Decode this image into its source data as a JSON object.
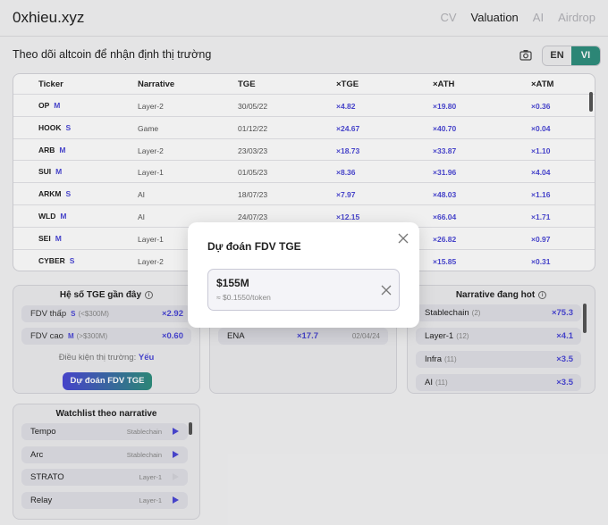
{
  "brand": "0xhieu.xyz",
  "nav": [
    "CV",
    "Valuation",
    "AI",
    "Airdrop"
  ],
  "nav_active": "Valuation",
  "subtitle": "Theo dõi altcoin để nhận định thị trường",
  "lang": {
    "en": "EN",
    "vi": "VI"
  },
  "table": {
    "headers": [
      "Ticker",
      "Narrative",
      "TGE",
      "×TGE",
      "×ATH",
      "×ATM"
    ],
    "rows": [
      {
        "ticker": "OP",
        "tag": "M",
        "narrative": "Layer-2",
        "tge": "30/05/22",
        "x_tge": "×4.82",
        "x_ath": "×19.80",
        "x_atm": "×0.36"
      },
      {
        "ticker": "HOOK",
        "tag": "S",
        "narrative": "Game",
        "tge": "01/12/22",
        "x_tge": "×24.67",
        "x_ath": "×40.70",
        "x_atm": "×0.04"
      },
      {
        "ticker": "ARB",
        "tag": "M",
        "narrative": "Layer-2",
        "tge": "23/03/23",
        "x_tge": "×18.73",
        "x_ath": "×33.87",
        "x_atm": "×1.10"
      },
      {
        "ticker": "SUI",
        "tag": "M",
        "narrative": "Layer-1",
        "tge": "01/05/23",
        "x_tge": "×8.36",
        "x_ath": "×31.96",
        "x_atm": "×4.04"
      },
      {
        "ticker": "ARKM",
        "tag": "S",
        "narrative": "AI",
        "tge": "18/07/23",
        "x_tge": "×7.97",
        "x_ath": "×48.03",
        "x_atm": "×1.16"
      },
      {
        "ticker": "WLD",
        "tag": "M",
        "narrative": "AI",
        "tge": "24/07/23",
        "x_tge": "×12.15",
        "x_ath": "×66.04",
        "x_atm": "×1.71"
      },
      {
        "ticker": "SEI",
        "tag": "M",
        "narrative": "Layer-1",
        "tge": "",
        "x_tge": "",
        "x_ath": "×26.82",
        "x_atm": "×0.97"
      },
      {
        "ticker": "CYBER",
        "tag": "S",
        "narrative": "Layer-2",
        "tge": "",
        "x_tge": "",
        "x_ath": "×15.85",
        "x_atm": "×0.31"
      }
    ]
  },
  "tge_panel": {
    "title": "Hệ số TGE gần đây",
    "rows": [
      {
        "label": "FDV thấp",
        "tag": "S",
        "range": "(<$300M)",
        "value": "×2.92"
      },
      {
        "label": "FDV cao",
        "tag": "M",
        "range": "(>$300M)",
        "value": "×0.60"
      }
    ],
    "condition_label": "Điều kiện thị trường:",
    "condition_value": "Yếu",
    "button": "Dự đoán FDV TGE"
  },
  "middle_panel": {
    "row": {
      "ticker": "ENA",
      "value": "×17.7",
      "date": "02/04/24"
    }
  },
  "hot_panel": {
    "title": "Narrative đang hot",
    "rows": [
      {
        "name": "Stablechain",
        "count": "(2)",
        "value": "×75.3"
      },
      {
        "name": "Layer-1",
        "count": "(12)",
        "value": "×4.1"
      },
      {
        "name": "Infra",
        "count": "(11)",
        "value": "×3.5"
      },
      {
        "name": "AI",
        "count": "(11)",
        "value": "×3.5"
      }
    ]
  },
  "watchlist": {
    "title": "Watchlist theo narrative",
    "items": [
      {
        "name": "Tempo",
        "category": "Stablechain"
      },
      {
        "name": "Arc",
        "category": "Stablechain"
      },
      {
        "name": "STRATO",
        "category": "Layer-1"
      },
      {
        "name": "Relay",
        "category": "Layer-1"
      }
    ]
  },
  "modal": {
    "title": "Dự đoán FDV TGE",
    "value": "$155M",
    "per_token": "≈ $0.1550/token"
  },
  "colors": {
    "accent": "#4b48d6",
    "teal": "#2f8f7e"
  }
}
